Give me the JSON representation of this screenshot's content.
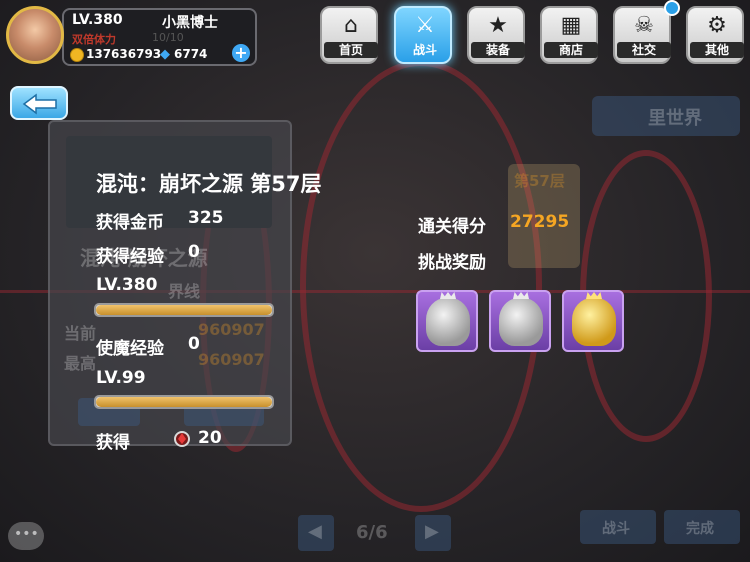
{
  "player": {
    "level": "LV.380",
    "name": "小黑博士",
    "stamina_label": "双倍体力",
    "stamina_value": "10/10",
    "gold": "137636793",
    "gems": "6774"
  },
  "nav": [
    {
      "label": "首页",
      "icon": "home-icon"
    },
    {
      "label": "战斗",
      "icon": "battle-icon"
    },
    {
      "label": "装备",
      "icon": "gun-star-icon"
    },
    {
      "label": "商店",
      "icon": "shop-icon"
    },
    {
      "label": "社交",
      "icon": "skull-icon"
    },
    {
      "label": "其他",
      "icon": "gear-icon"
    }
  ],
  "background": {
    "world_button": "里世界",
    "stage_tag": "第57层",
    "ghost_title": "混沌·崩坏之源",
    "ghost_sub": "界线",
    "ghost_current": "当前",
    "ghost_best": "最高",
    "ghost_num1": "960907",
    "ghost_num2": "960907",
    "pager": "6/6",
    "btn_left": "战斗",
    "btn_right": "完成"
  },
  "result": {
    "title": "混沌：崩坏之源 第57层",
    "gold_label": "获得金币",
    "gold_value": "325",
    "exp_label": "获得经验",
    "exp_value": "0",
    "level": "LV.380",
    "level_progress": 1.0,
    "pet_exp_label": "使魔经验",
    "pet_exp_value": "0",
    "pet_level": "LV.99",
    "pet_progress": 1.0,
    "obtain_label": "获得",
    "obtain_value": "20",
    "score_label": "通关得分",
    "score_value": "27295",
    "reward_label": "挑战奖励"
  },
  "rewards": [
    {
      "type": "silver-bear"
    },
    {
      "type": "silver-bear"
    },
    {
      "type": "gold-bear"
    }
  ],
  "colors": {
    "score": "#f5a623",
    "accent": "#2aa0e8"
  }
}
